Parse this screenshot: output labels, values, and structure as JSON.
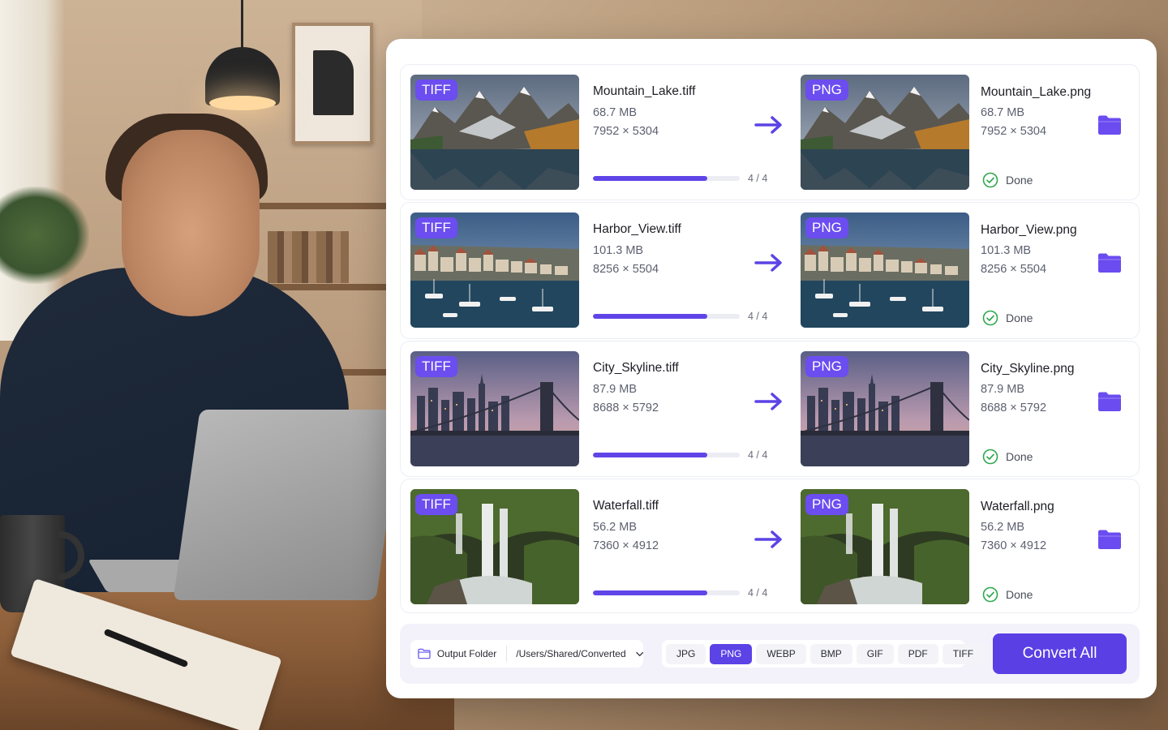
{
  "colors": {
    "accent": "#5b43e6",
    "badge": "#6b4df0",
    "success": "#2fa84f",
    "progress_track": "#ececf3"
  },
  "files": [
    {
      "thumb": "mountain",
      "source": {
        "badge": "TIFF",
        "name": "Mountain_Lake.tiff",
        "size": "68.7 MB",
        "dimensions": "7952 × 5304"
      },
      "progress": {
        "count": "4 / 4",
        "fraction": 0.78
      },
      "output": {
        "badge": "PNG",
        "name": "Mountain_Lake.png",
        "size": "68.7 MB",
        "dimensions": "7952 × 5304",
        "status": "Done"
      },
      "icons": {
        "arrow": "arrow-right-icon",
        "status": "check-circle-icon",
        "folder": "folder-icon"
      }
    },
    {
      "thumb": "harbor",
      "source": {
        "badge": "TIFF",
        "name": "Harbor_View.tiff",
        "size": "101.3 MB",
        "dimensions": "8256 × 5504"
      },
      "progress": {
        "count": "4 / 4",
        "fraction": 0.78
      },
      "output": {
        "badge": "PNG",
        "name": "Harbor_View.png",
        "size": "101.3 MB",
        "dimensions": "8256 × 5504",
        "status": "Done"
      },
      "icons": {
        "arrow": "arrow-right-icon",
        "status": "check-circle-icon",
        "folder": "folder-icon"
      }
    },
    {
      "thumb": "city",
      "source": {
        "badge": "TIFF",
        "name": "City_Skyline.tiff",
        "size": "87.9 MB",
        "dimensions": "8688 × 5792"
      },
      "progress": {
        "count": "4 / 4",
        "fraction": 0.78
      },
      "output": {
        "badge": "PNG",
        "name": "City_Skyline.png",
        "size": "87.9 MB",
        "dimensions": "8688 × 5792",
        "status": "Done"
      },
      "icons": {
        "arrow": "arrow-right-icon",
        "status": "check-circle-icon",
        "folder": "folder-icon"
      }
    },
    {
      "thumb": "waterfall",
      "source": {
        "badge": "TIFF",
        "name": "Waterfall.tiff",
        "size": "56.2 MB",
        "dimensions": "7360 × 4912"
      },
      "progress": {
        "count": "4 / 4",
        "fraction": 0.78
      },
      "output": {
        "badge": "PNG",
        "name": "Waterfall.png",
        "size": "56.2 MB",
        "dimensions": "7360 × 4912",
        "status": "Done"
      },
      "icons": {
        "arrow": "arrow-right-icon",
        "status": "check-circle-icon",
        "folder": "folder-icon"
      }
    }
  ],
  "toolbar": {
    "output_label": "Output Folder",
    "output_path": "/Users/Shared/Converted",
    "formats": [
      "JPG",
      "PNG",
      "WEBP",
      "BMP",
      "GIF",
      "PDF",
      "TIFF"
    ],
    "selected_format": "PNG",
    "convert_label": "Convert All",
    "icons": {
      "folder": "folder-outline-icon",
      "dropdown": "chevron-down-icon"
    }
  }
}
